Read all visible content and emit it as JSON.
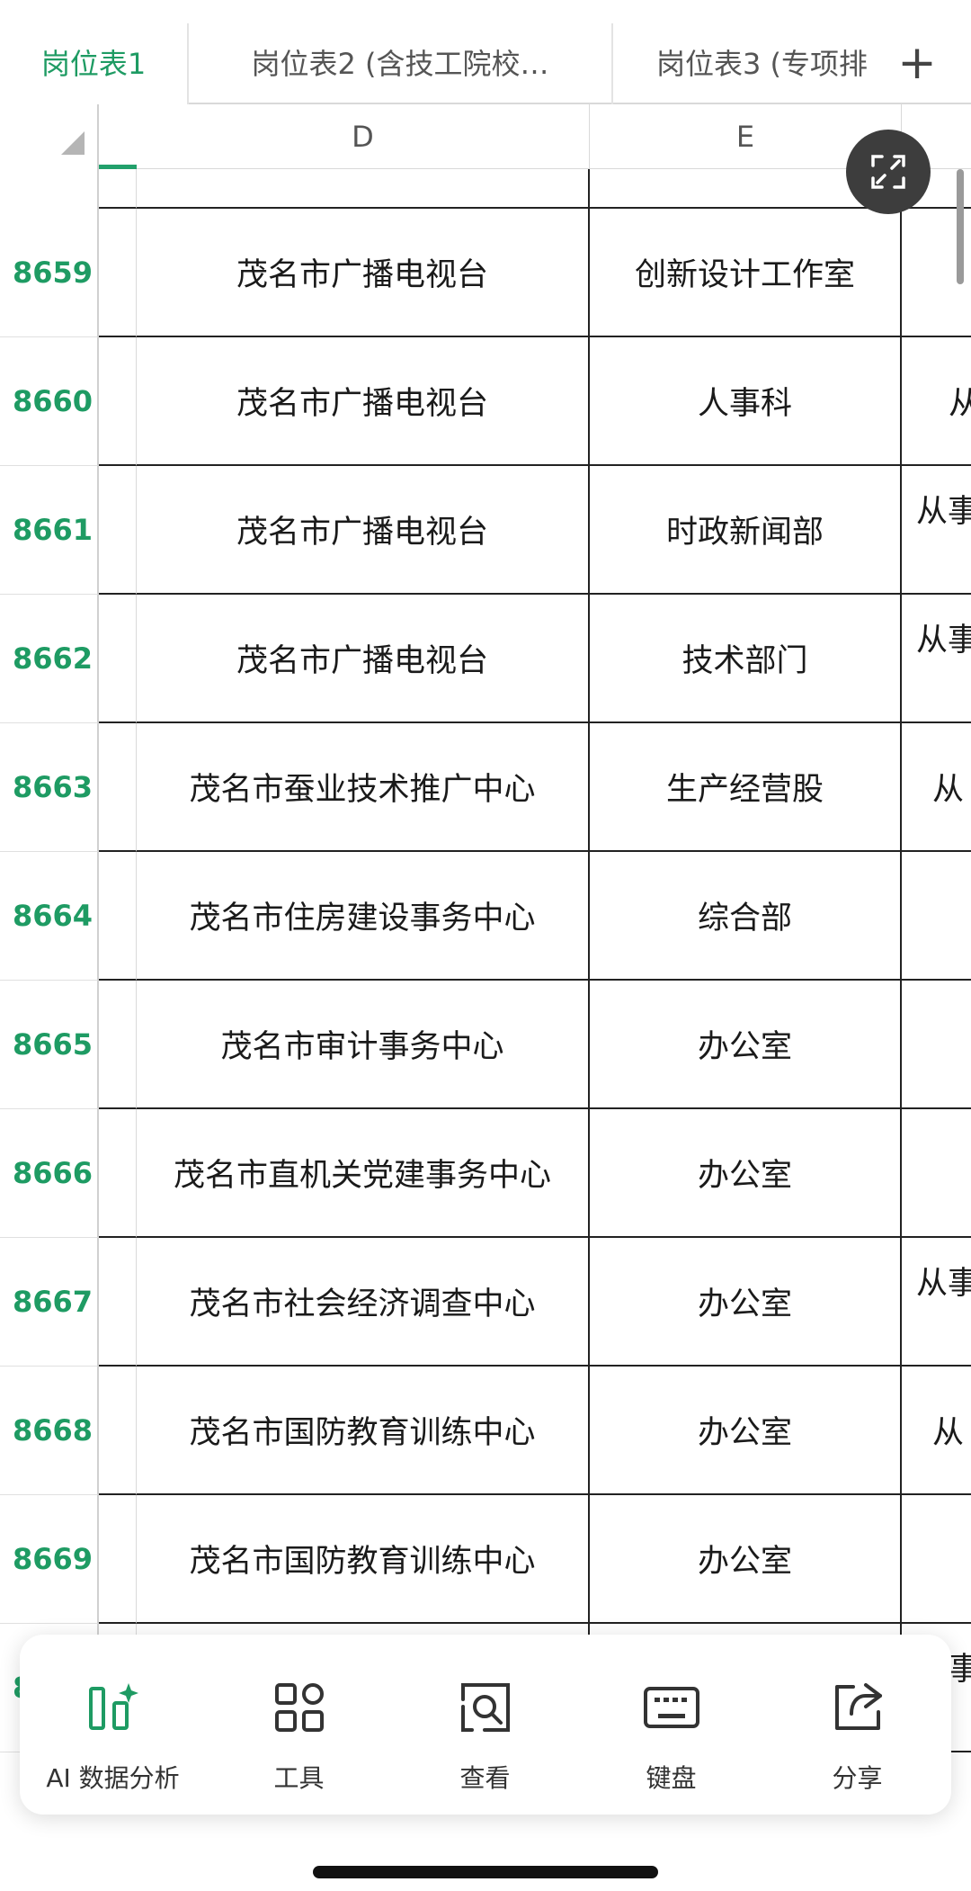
{
  "tabs": [
    {
      "label": "岗位表1",
      "active": true
    },
    {
      "label": "岗位表2 (含技工院校…",
      "active": false
    },
    {
      "label": "岗位表3 (专项排",
      "active": false
    }
  ],
  "add_tab_symbol": "+",
  "columns": {
    "d": "D",
    "e": "E"
  },
  "rows": [
    {
      "num": "8659",
      "d": "茂名市广播电视台",
      "e": "创新设计工作室",
      "f": ""
    },
    {
      "num": "8660",
      "d": "茂名市广播电视台",
      "e": "人事科",
      "f": "从"
    },
    {
      "num": "8661",
      "d": "茂名市广播电视台",
      "e": "时政新闻部",
      "f": "从事"
    },
    {
      "num": "8662",
      "d": "茂名市广播电视台",
      "e": "技术部门",
      "f": "从事"
    },
    {
      "num": "8663",
      "d": "茂名市蚕业技术推广中心",
      "e": "生产经营股",
      "f": "从"
    },
    {
      "num": "8664",
      "d": "茂名市住房建设事务中心",
      "e": "综合部",
      "f": ""
    },
    {
      "num": "8665",
      "d": "茂名市审计事务中心",
      "e": "办公室",
      "f": ""
    },
    {
      "num": "8666",
      "d": "茂名市直机关党建事务中心",
      "e": "办公室",
      "f": ""
    },
    {
      "num": "8667",
      "d": "茂名市社会经济调查中心",
      "e": "办公室",
      "f": "从事"
    },
    {
      "num": "8668",
      "d": "茂名市国防教育训练中心",
      "e": "办公室",
      "f": "从"
    },
    {
      "num": "8669",
      "d": "茂名市国防教育训练中心",
      "e": "办公室",
      "f": ""
    },
    {
      "num": "8",
      "d": "",
      "e": "",
      "f": "事"
    }
  ],
  "toolbar": [
    {
      "label": "AI 数据分析",
      "icon": "ai-analysis-icon"
    },
    {
      "label": "工具",
      "icon": "tools-grid-icon"
    },
    {
      "label": "查看",
      "icon": "view-search-icon"
    },
    {
      "label": "键盘",
      "icon": "keyboard-icon"
    },
    {
      "label": "分享",
      "icon": "share-icon"
    }
  ],
  "colors": {
    "accent": "#1e9b63",
    "grid_line": "#222222"
  }
}
